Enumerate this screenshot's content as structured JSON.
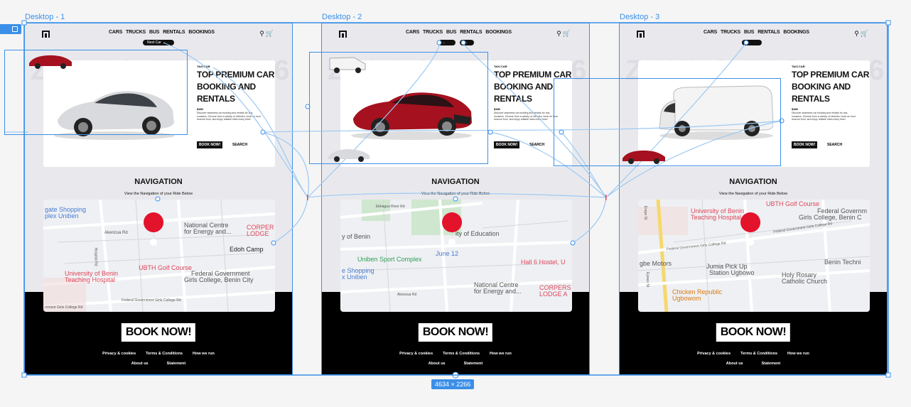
{
  "frames": [
    {
      "label": "Desktop - 1",
      "pill": "Next Car"
    },
    {
      "label": "Desktop - 2",
      "pill": ""
    },
    {
      "label": "Desktop - 3",
      "pill": ""
    }
  ],
  "nav": {
    "items": [
      "CARS",
      "TRUCKS",
      "BUS",
      "RENTALS",
      "BOOKINGS"
    ],
    "search_icon": "search-icon",
    "cart_icon": "cart-icon"
  },
  "hero": {
    "watermark": "ZUKKO TESLA 56",
    "tag": "TAXI CAR",
    "title": "TOP PREMIUM CAR BOOKING AND RENTALS",
    "price": "$480",
    "description": "Discover seamless car booking and rentals for any occasion. Choose from a variety of vehicles, book an hour reserve from, and enjoy reliable rides every time!",
    "book_label": "BOOK NOW!",
    "search_label": "SEARCH"
  },
  "navigation": {
    "title": "NAVIGATION",
    "subtitle": "View the Navigation of your Ride Below"
  },
  "maps": [
    {
      "labels": [
        "gate Shopping",
        "plex Uniben",
        "Akenzua Rd",
        "National Centre",
        "for Energy and...",
        "CORPER",
        "LODGE",
        "Edoh Camp",
        "UBTH Golf Course",
        "University of Benin",
        "Teaching Hospital",
        "Federal Government",
        "Girls College, Benin City",
        "Hospital Rd",
        "rnment Girls College Rd",
        "Federal Government Girls College Rd"
      ]
    },
    {
      "labels": [
        "Ekhaguo River Rd",
        "y of Benin",
        "ity of Education",
        "June 12",
        "Uniben Sport Complex",
        "e Shopping",
        "x Uniben",
        "Hall 6 Hostel, U",
        "National Centre",
        "for Energy and...",
        "CORPERS",
        "LODGE A",
        "Akenzua Rd"
      ]
    },
    {
      "labels": [
        "UBTH Golf Course",
        "University of Benin",
        "Teaching Hospital",
        "Federal Governm",
        "Girls College, Benin C",
        "Federal Government Girls College Rd",
        "Federal Government Girls College Rd",
        "gbe Motors",
        "Jumia Pick Up",
        "Station Ugbowo",
        "Holy Rosary",
        "Catholic Church",
        "Benin Techni",
        "Chicken Republic",
        "Ugbowom",
        "Erepe St",
        "Eyewo St"
      ]
    }
  ],
  "footer": {
    "cta": "BOOK NOW!",
    "links_row1": [
      "Privacy & cookies",
      "Terms & Conditions",
      "How we run"
    ],
    "links_row2": [
      "About us",
      "Statement"
    ]
  },
  "selection": {
    "size_label": "4634 × 2266"
  },
  "colors": {
    "selection_blue": "#3b8fe8",
    "map_pin_red": "#e3132b",
    "footer_black": "#000000",
    "hero_bg": "#e9e9ed"
  }
}
